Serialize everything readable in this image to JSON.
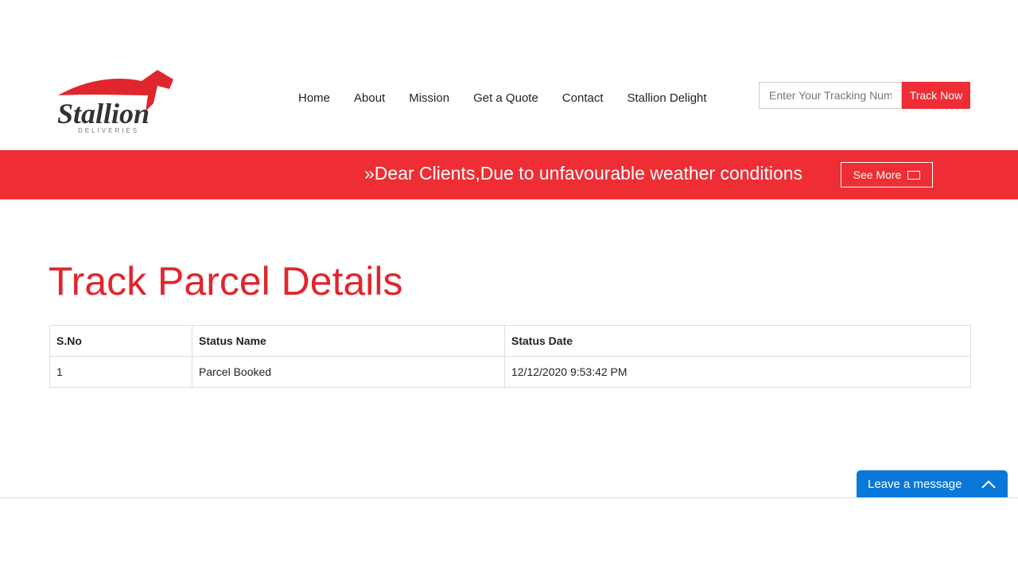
{
  "brand": {
    "name": "Stallion",
    "sub": "DELIVERIES",
    "accent": "#ee2d34"
  },
  "nav": [
    {
      "label": "Home"
    },
    {
      "label": "About"
    },
    {
      "label": "Mission"
    },
    {
      "label": "Get a Quote"
    },
    {
      "label": "Contact"
    },
    {
      "label": "Stallion Delight"
    }
  ],
  "tracking": {
    "placeholder": "Enter Your Tracking Number",
    "button": "Track Now"
  },
  "banner": {
    "text": "»Dear Clients,Due to unfavourable weather conditions",
    "see_more": "See More",
    "icon": "newspaper-icon"
  },
  "page_title": "Track Parcel Details",
  "table": {
    "headers": [
      "S.No",
      "Status Name",
      "Status Date"
    ],
    "rows": [
      [
        "1",
        "Parcel Booked",
        "12/12/2020 9:53:42 PM"
      ]
    ]
  },
  "chat": {
    "label": "Leave a message",
    "icon": "chevron-up-icon",
    "color": "#0a78d8"
  }
}
